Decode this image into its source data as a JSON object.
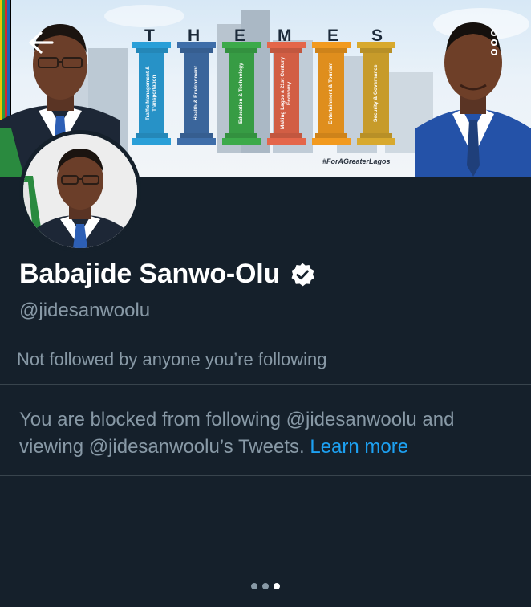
{
  "banner": {
    "themes_letters": [
      "T",
      "H",
      "E",
      "M",
      "E",
      "S"
    ],
    "pillars": [
      {
        "label": "Traffic Management & Transportation",
        "color": "#2a9fd8"
      },
      {
        "label": "Health & Environment",
        "color": "#3f6ea9"
      },
      {
        "label": "Education & Technology",
        "color": "#3caa4a"
      },
      {
        "label": "Making Lagos a 21st Century Economy",
        "color": "#e4664a"
      },
      {
        "label": "Entertainment & Tourism",
        "color": "#f29a1f"
      },
      {
        "label": "Security & Governance",
        "color": "#d8a92e"
      }
    ],
    "hashtag": "#ForAGreaterLagos"
  },
  "profile": {
    "display_name": "Babajide Sanwo-Olu",
    "handle": "@jidesanwoolu",
    "follow_note": "Not followed by anyone you’re following",
    "blocked_text": "You are blocked from following @jidesanwoolu and viewing @jidesanwoolu’s Tweets.",
    "learn_more": "Learn more"
  },
  "icons": {
    "back": "arrow-left-icon",
    "more": "more-vertical-icon",
    "verified": "verified-badge-icon"
  },
  "pager": {
    "count": 3,
    "active": 3
  },
  "colors": {
    "background": "#15202b",
    "text_primary": "#ffffff",
    "text_secondary": "#8899a6",
    "link": "#1da1f2",
    "divider": "#38444d"
  }
}
